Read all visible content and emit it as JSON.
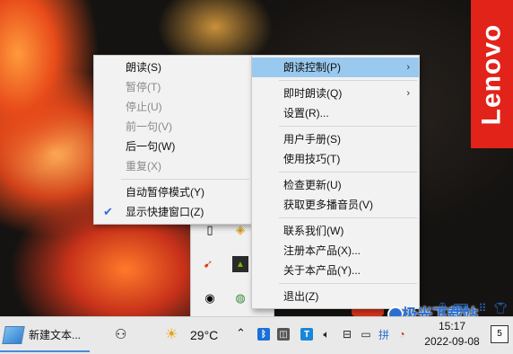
{
  "desktop": {
    "brand_text": "Lenovo"
  },
  "left_menu": {
    "items": [
      {
        "label": "朗读(S)",
        "disabled": false
      },
      {
        "label": "暂停(T)",
        "disabled": true
      },
      {
        "label": "停止(U)",
        "disabled": true
      },
      {
        "label": "前一句(V)",
        "disabled": true
      },
      {
        "label": "后一句(W)",
        "disabled": false
      },
      {
        "label": "重复(X)",
        "disabled": true
      },
      {
        "label": "自动暂停模式(Y)",
        "disabled": false
      },
      {
        "label": "显示快捷窗口(Z)",
        "disabled": false,
        "checked": true
      }
    ]
  },
  "right_menu": {
    "items": [
      {
        "label": "朗读控制(P)",
        "submenu": true,
        "highlighted": true
      },
      {
        "label": "即时朗读(Q)",
        "submenu": true
      },
      {
        "label": "设置(R)..."
      },
      {
        "label": "用户手册(S)"
      },
      {
        "label": "使用技巧(T)"
      },
      {
        "label": "检查更新(U)"
      },
      {
        "label": "获取更多播音员(V)"
      },
      {
        "label": "联系我们(W)"
      },
      {
        "label": "注册本产品(X)..."
      },
      {
        "label": "关于本产品(Y)..."
      },
      {
        "label": "退出(Z)"
      }
    ]
  },
  "taskbar": {
    "app_label": "新建文本...",
    "weather_temp": "29°C",
    "clock_time": "15:17",
    "clock_date": "2022-09-08",
    "notification_count": "5"
  },
  "watermark": {
    "text": "极光下载站"
  },
  "colors": {
    "menu_highlight": "#99c9ef",
    "check_blue": "#2b6dd6",
    "lenovo_red": "#e2231a"
  }
}
